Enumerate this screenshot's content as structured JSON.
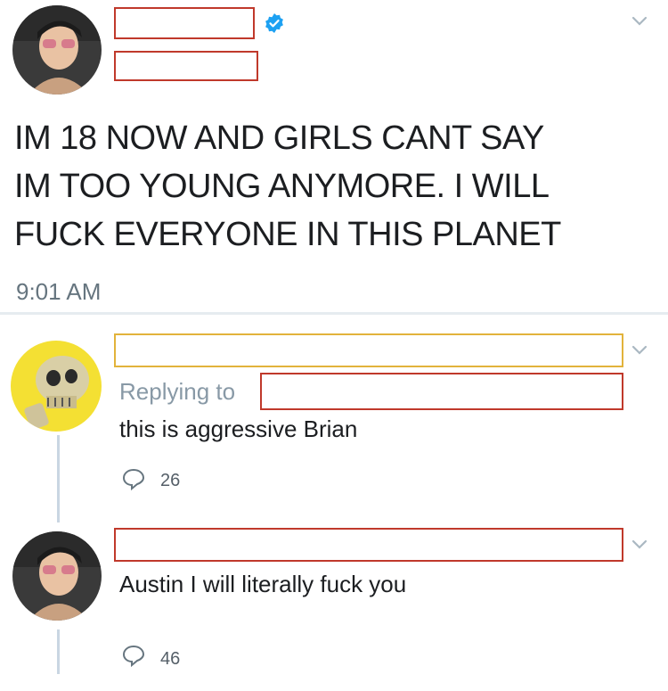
{
  "tweet": {
    "text": "IM 18 NOW AND GIRLS CANT SAY\nIM TOO YOUNG ANYMORE. I WILL\nFUCK EVERYONE IN THIS PLANET",
    "time": "9:01 AM"
  },
  "replies": [
    {
      "replying_label": "Replying to",
      "text": "this is aggressive Brian",
      "reply_count": "26"
    },
    {
      "text": "Austin I will literally fuck you",
      "reply_count": "46"
    }
  ],
  "colors": {
    "redaction": "#c0392b",
    "redaction_alt": "#e2b33b",
    "verified": "#1da1f2",
    "muted": "#8899a6"
  }
}
